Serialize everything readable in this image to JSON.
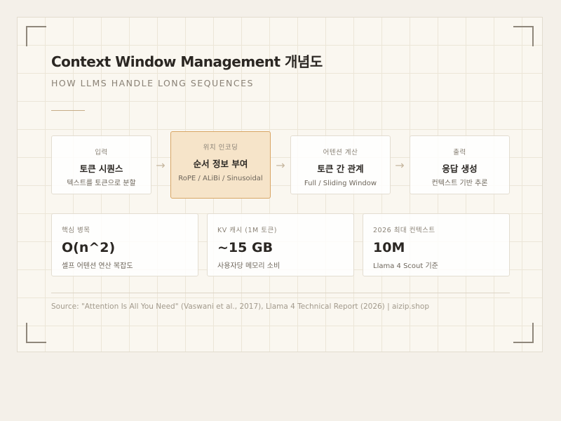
{
  "header": {
    "title": "Context Window Management 개념도",
    "subtitle": "HOW LLMS HANDLE LONG SEQUENCES"
  },
  "pipeline": [
    {
      "label": "입력",
      "title": "토큰 시퀀스",
      "sub": "텍스트를 토큰으로 분할"
    },
    {
      "label": "위치 인코딩",
      "title": "순서 정보 부여",
      "sub": "RoPE / ALiBi / Sinusoidal"
    },
    {
      "label": "어텐션 계산",
      "title": "토큰 간 관계",
      "sub": "Full / Sliding Window"
    },
    {
      "label": "출력",
      "title": "응답 생성",
      "sub": "컨텍스트 기반 추론"
    }
  ],
  "arrow_glyph": "→",
  "stats": [
    {
      "label": "핵심 병목",
      "value": "O(n^2)",
      "note": "셀프 어텐션 연산 복잡도"
    },
    {
      "label": "KV 캐시 (1M 토큰)",
      "value": "~15 GB",
      "note": "사용자당 메모리 소비"
    },
    {
      "label": "2026 최대 컨텍스트",
      "value": "10M",
      "note": "Llama 4 Scout 기준"
    }
  ],
  "footer": {
    "source": "Source: \"Attention Is All You Need\" (Vaswani et al., 2017), Llama 4 Technical Report (2026) | aizip.shop"
  },
  "colors": {
    "background": "#f4f0e9",
    "card": "#faf7f0",
    "active_fill": "#f6e4c9",
    "active_border": "#d8a666",
    "accent": "#c6ad87"
  }
}
